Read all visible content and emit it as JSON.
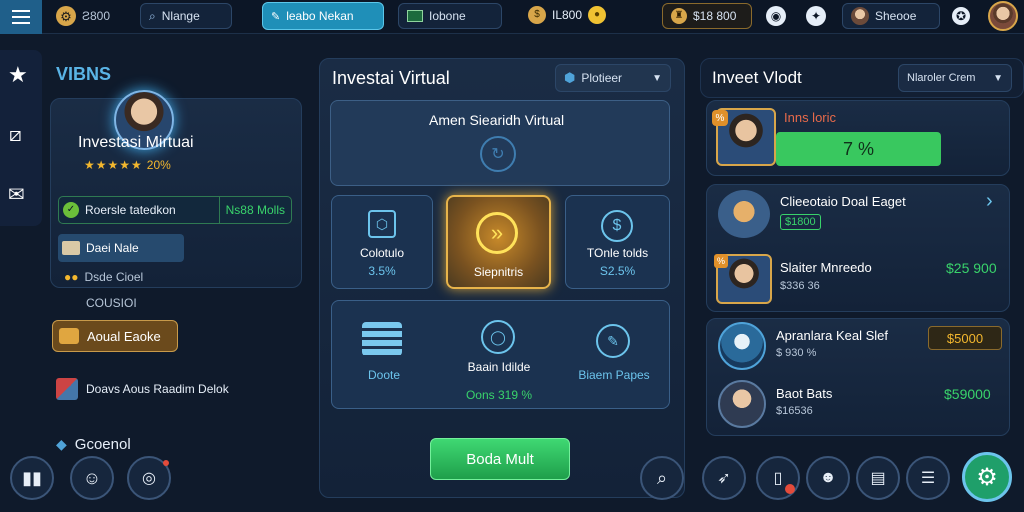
{
  "topbar": {
    "search_label": "Nlange",
    "active_tab": "leabo Nekan",
    "tab2": "Iobone",
    "currency_amount": "IL800",
    "pill_amount": "$18 800",
    "user_name": "Sheooe"
  },
  "left": {
    "section_title": "VIBNS",
    "profile_name": "Investasi Mirtuai",
    "rating": "20%",
    "stat_label": "Roersle tatedkon",
    "stat_value": "Ns88 Molls",
    "chip_label": "Daei Nale",
    "item_text": "Dsde Cioel",
    "caption": "COUSIOI",
    "gold_button": "Aoual Eaoke",
    "news_text": "Doavs Aous Raadim Delok",
    "footer_label": "Gcoenol"
  },
  "center": {
    "title": "Investai Virtual",
    "dropdown": "Plotieer",
    "banner_title": "Amen Siearidh Virtual",
    "cards": [
      {
        "label": "Colotulo",
        "value": "3.5%"
      },
      {
        "label": "Siepnitris",
        "value": ""
      },
      {
        "label": "TOnle tolds",
        "value": "S2.5%"
      }
    ],
    "lower_items": [
      {
        "label": "Doote"
      },
      {
        "label": "Baain Idilde"
      },
      {
        "label": "Biaem Papes"
      }
    ],
    "lower_sub": "Oons 319 %",
    "primary_button": "Boda Mult"
  },
  "right": {
    "title": "Inveet Vlodt",
    "dropdown": "Nlaroler Crem",
    "feature": {
      "name": "Inns loric",
      "percent": "7 %"
    },
    "list": [
      {
        "name": "Clieeotaio Doal Eaget",
        "sub": "$1800",
        "value": ""
      },
      {
        "name": "Slaiter Mnreedo",
        "sub": "$336 36",
        "value": "$25 900"
      },
      {
        "name": "Apranlara Keal Slef",
        "sub": "$ 930 %",
        "value": "$5000"
      },
      {
        "name": "Baot Bats",
        "sub": "$16536",
        "value": "$59000"
      }
    ]
  },
  "colors": {
    "accent": "#39d36b",
    "gold": "#d8a64a",
    "cyan": "#2aa3c9"
  }
}
